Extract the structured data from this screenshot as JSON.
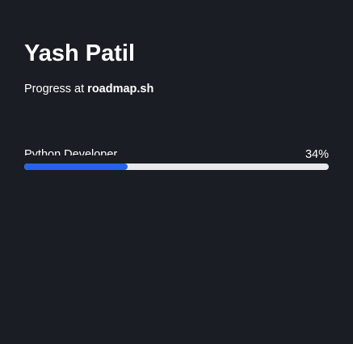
{
  "profile": {
    "name": "Yash Patil",
    "subtitle_prefix": "Progress at ",
    "subtitle_site": "roadmap.sh"
  },
  "progress": {
    "label": "Python Developer",
    "percent_text": "34%",
    "fraction": 0.34
  },
  "colors": {
    "background": "#1a1d23",
    "text": "#ffffff",
    "track": "#e7e7ec",
    "fill": "#2563eb"
  }
}
